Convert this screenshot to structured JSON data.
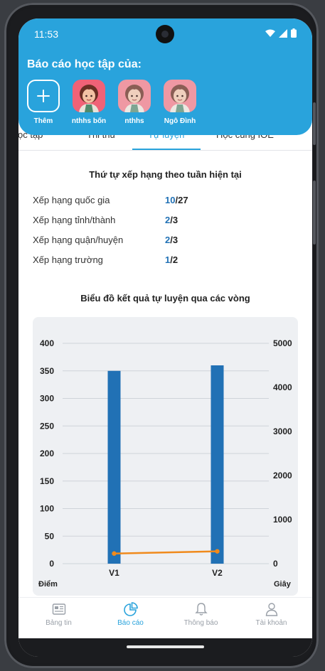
{
  "status": {
    "time": "11:53"
  },
  "header": {
    "title": "Báo cáo học tập của:",
    "add_label": "Thêm",
    "profiles": [
      {
        "name": "nthhs bốn",
        "avatar": "girl-avatar-icon"
      },
      {
        "name": "nthhs",
        "avatar": "girl-avatar-icon"
      },
      {
        "name": "Ngô Đình",
        "avatar": "girl-avatar-icon"
      }
    ]
  },
  "tabs": [
    "ọc tập",
    "Thi thử",
    "Tự luyện",
    "Học cùng IOE"
  ],
  "active_tab": "Tự luyện",
  "ranking": {
    "title": "Thứ tự xếp hạng theo tuần hiện tại",
    "rows": [
      {
        "label": "Xếp hạng quốc gia",
        "current": "10",
        "sep": "/",
        "total": "27"
      },
      {
        "label": "Xếp hạng tỉnh/thành",
        "current": "2",
        "sep": "/",
        "total": "3"
      },
      {
        "label": "Xếp hạng quận/huyện",
        "current": "2",
        "sep": "/",
        "total": "3"
      },
      {
        "label": "Xếp hạng trường",
        "current": "1",
        "sep": "/",
        "total": "2"
      }
    ]
  },
  "chart_title": "Biểu đồ kết quả tự luyện qua các vòng",
  "chart_data": {
    "type": "bar",
    "categories": [
      "V1",
      "V2"
    ],
    "series": [
      {
        "values": [
          350,
          360
        ],
        "axis": "left",
        "type": "bar",
        "color": "#2171b5"
      },
      {
        "values": [
          230,
          280
        ],
        "axis": "right",
        "type": "line",
        "color": "#f08a1c"
      }
    ],
    "xlabel": "",
    "ylabel_left": "Điểm",
    "ylabel_right": "Giây",
    "ylim_left": [
      0,
      400
    ],
    "ylim_right": [
      0,
      5000
    ],
    "yticks_left": [
      "400",
      "350",
      "300",
      "250",
      "200",
      "150",
      "100",
      "50",
      "0"
    ],
    "yticks_right": [
      "5000",
      "4000",
      "3000",
      "2000",
      "1000",
      "0"
    ],
    "grid": true,
    "legend": "none"
  },
  "nav": [
    {
      "label": "Bảng tin",
      "icon": "newspaper-icon"
    },
    {
      "label": "Báo cáo",
      "icon": "pie-chart-icon"
    },
    {
      "label": "Thông báo",
      "icon": "bell-icon"
    },
    {
      "label": "Tài khoản",
      "icon": "user-icon"
    }
  ],
  "colors": {
    "primary": "#29a3dc",
    "bar": "#2171b5",
    "line": "#f08a1c",
    "rank_current": "#2171b5"
  }
}
